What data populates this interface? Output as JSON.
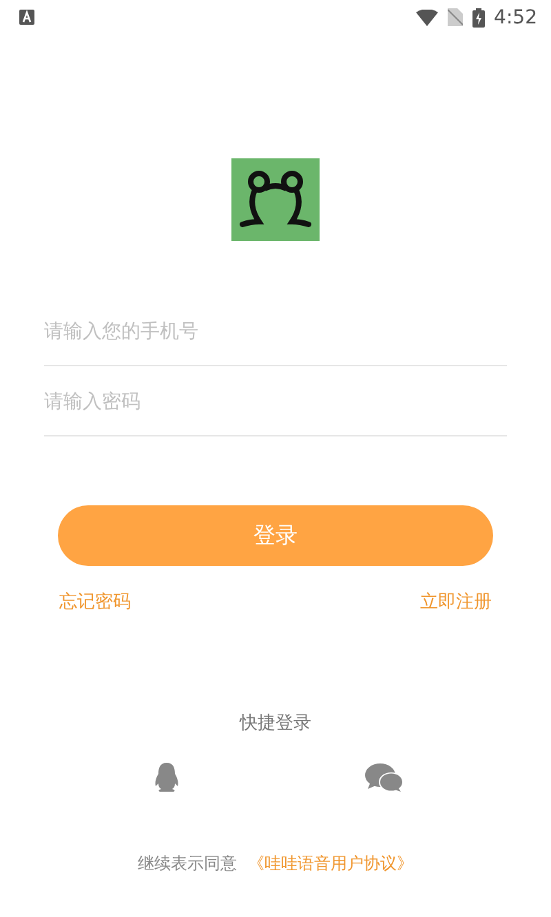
{
  "status_bar": {
    "time": "4:52"
  },
  "phone_field": {
    "placeholder": "请输入您的手机号"
  },
  "password_field": {
    "placeholder": "请输入密码"
  },
  "login_button": "登录",
  "forgot_password": "忘记密码",
  "register": "立即注册",
  "quick_login": {
    "title": "快捷登录"
  },
  "agreement": {
    "text": "继续表示同意",
    "link": "《哇哇语音用户协议》"
  }
}
